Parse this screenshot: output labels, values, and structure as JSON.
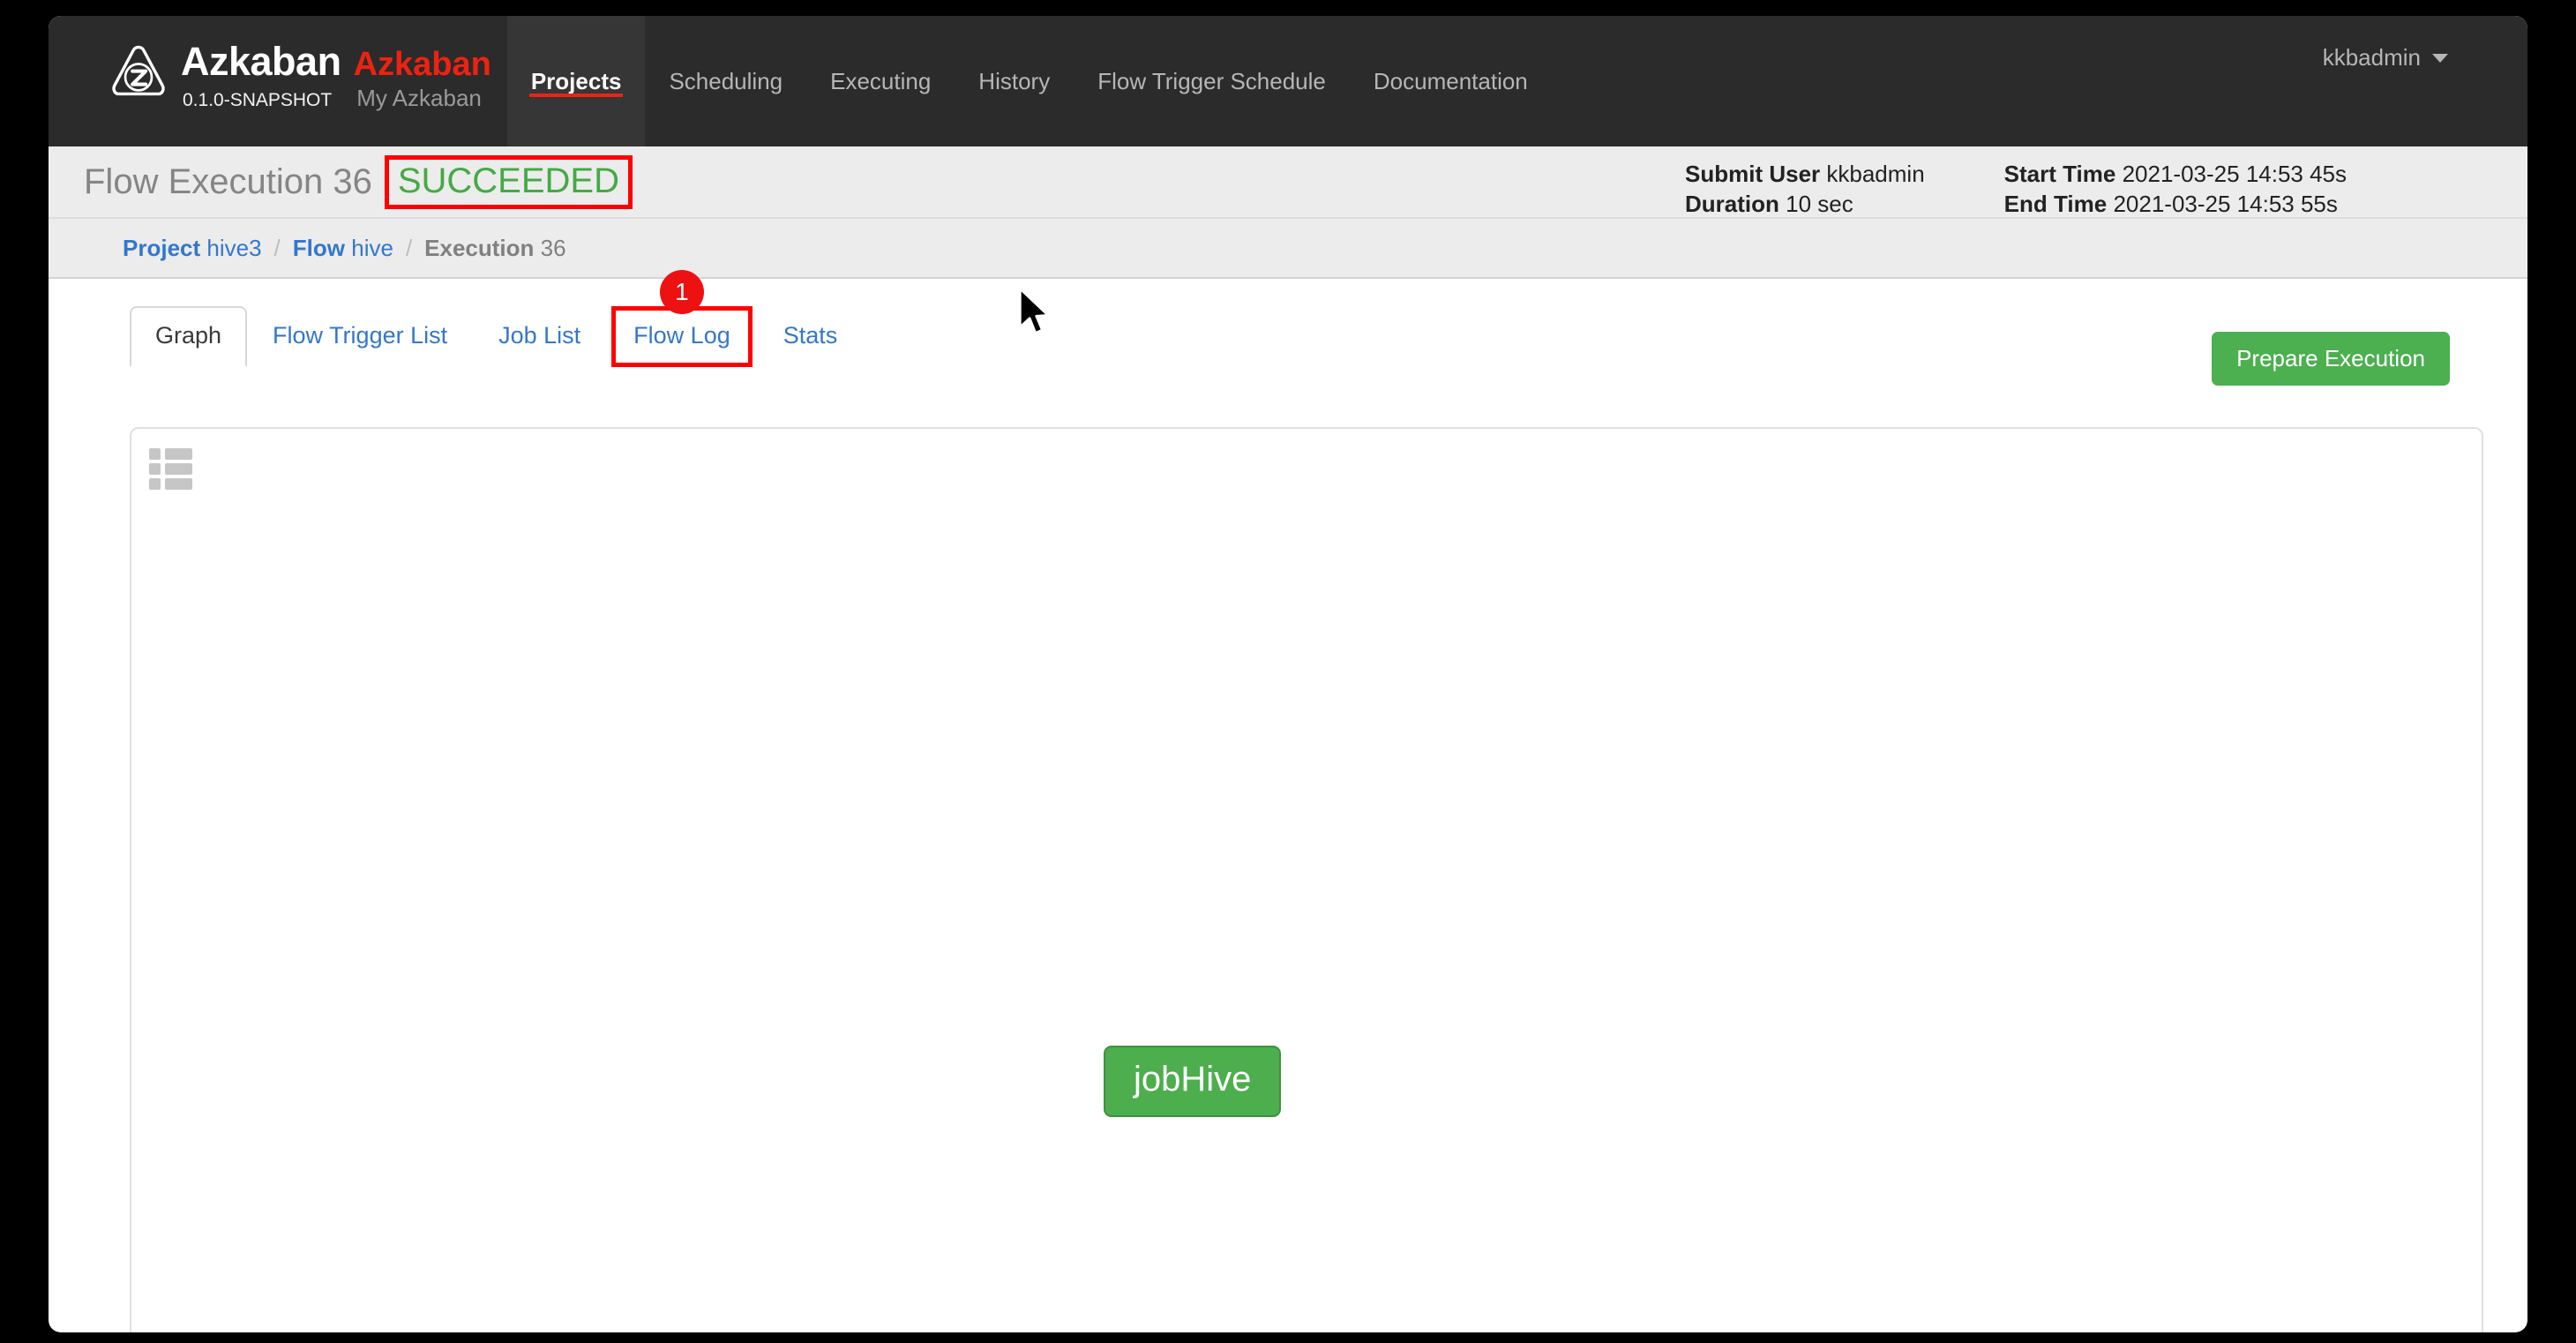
{
  "navbar": {
    "logo_icon": "azkaban-logo-icon",
    "brand_name": "Azkaban",
    "brand_sub": "Azkaban",
    "version": "0.1.0-SNAPSHOT",
    "tagline": "My Azkaban",
    "items": [
      {
        "label": "Projects",
        "active": true
      },
      {
        "label": "Scheduling",
        "active": false
      },
      {
        "label": "Executing",
        "active": false
      },
      {
        "label": "History",
        "active": false
      },
      {
        "label": "Flow Trigger Schedule",
        "active": false
      },
      {
        "label": "Documentation",
        "active": false
      }
    ],
    "user": "kkbadmin",
    "caret_icon": "chevron-down-icon"
  },
  "exec_header": {
    "title": "Flow Execution 36",
    "status": "SUCCEEDED",
    "status_color": "#44aa44",
    "annotation_color": "#ff0000",
    "meta": {
      "submit_user_label": "Submit User",
      "submit_user_value": "kkbadmin",
      "duration_label": "Duration",
      "duration_value": "10 sec",
      "start_time_label": "Start Time",
      "start_time_value": "2021-03-25 14:53 45s",
      "end_time_label": "End Time",
      "end_time_value": "2021-03-25 14:53 55s"
    }
  },
  "breadcrumb": {
    "separator": "/",
    "items": [
      {
        "label": "Project",
        "value": "hive3",
        "link": true
      },
      {
        "label": "Flow",
        "value": "hive",
        "link": true
      },
      {
        "label": "Execution",
        "value": "36",
        "link": false
      }
    ]
  },
  "tabs": {
    "items": [
      {
        "label": "Graph",
        "active": true,
        "annotated": false
      },
      {
        "label": "Flow Trigger List",
        "active": false,
        "annotated": false
      },
      {
        "label": "Job List",
        "active": false,
        "annotated": false
      },
      {
        "label": "Flow Log",
        "active": false,
        "annotated": true,
        "badge": "1"
      },
      {
        "label": "Stats",
        "active": false,
        "annotated": false
      }
    ],
    "prepare_button": "Prepare Execution",
    "prepare_button_color": "#4caf50"
  },
  "graph": {
    "legend_icon": "list-legend-icon",
    "nodes": [
      {
        "label": "jobHive",
        "status_color": "#4cae4c"
      }
    ]
  },
  "cursor": {
    "icon": "mouse-pointer-icon"
  }
}
